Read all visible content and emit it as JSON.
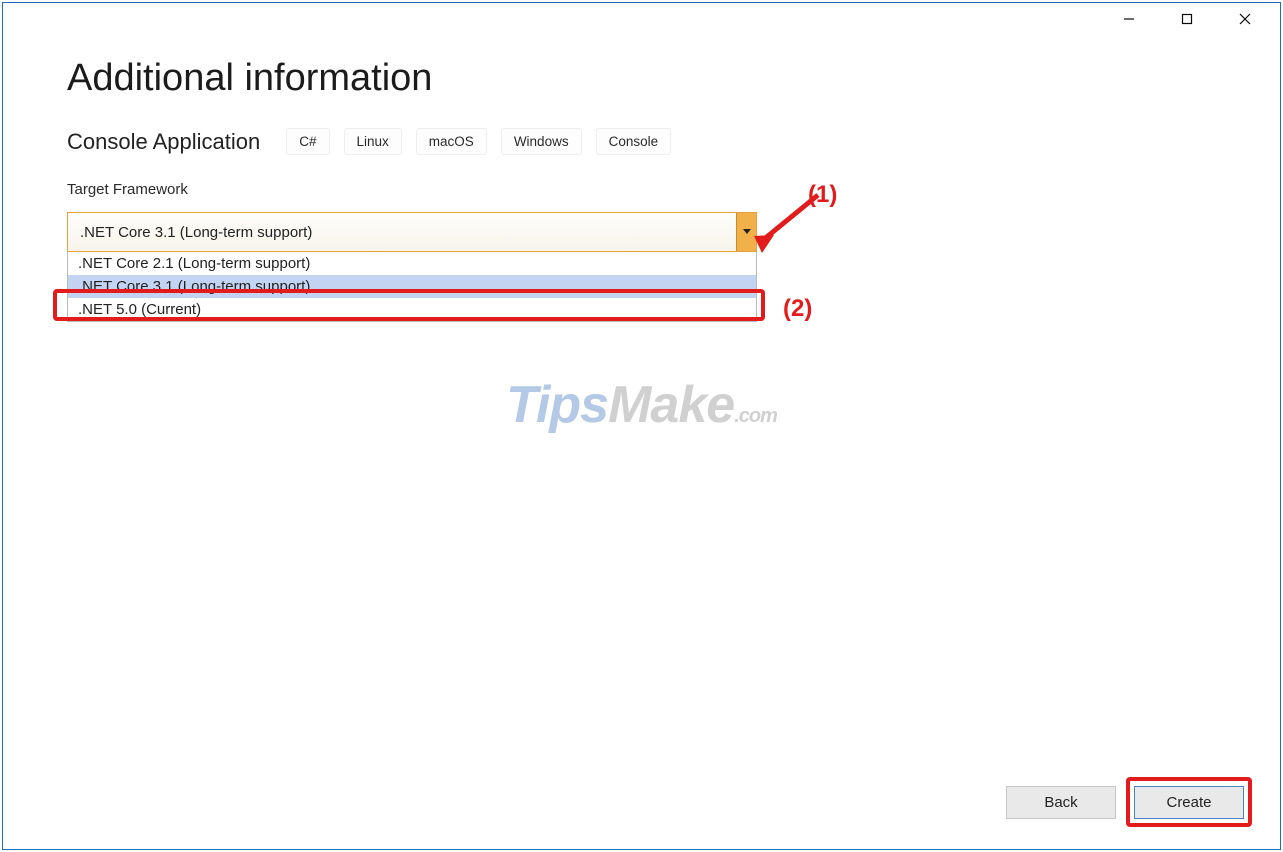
{
  "window": {
    "title": ""
  },
  "page": {
    "heading": "Additional information",
    "project_type": "Console Application",
    "tags": [
      "C#",
      "Linux",
      "macOS",
      "Windows",
      "Console"
    ],
    "framework_label": "Target Framework"
  },
  "select": {
    "selected": ".NET Core 3.1 (Long-term support)",
    "options": [
      ".NET Core 2.1 (Long-term support)",
      ".NET Core 3.1 (Long-term support)",
      ".NET 5.0 (Current)"
    ],
    "highlighted_index": 1
  },
  "annotations": {
    "label1": "(1)",
    "label2": "(2)"
  },
  "footer": {
    "back": "Back",
    "create": "Create"
  },
  "watermark": {
    "part1": "T",
    "part2": "ips",
    "part3": "M",
    "part4": "ake",
    "part5": ".com"
  }
}
